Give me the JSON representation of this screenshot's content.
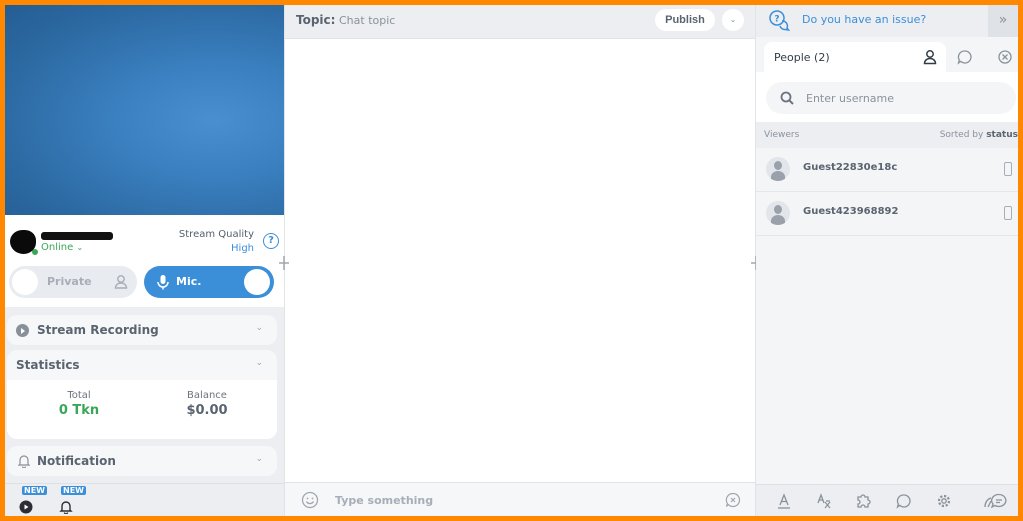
{
  "profile": {
    "status": "Online",
    "status_caret": "⌄",
    "stream_quality_label": "Stream Quality",
    "stream_quality_value": "High",
    "help_glyph": "?"
  },
  "toggles": {
    "private_label": "Private",
    "private_on": false,
    "mic_label": "Mic.",
    "mic_on": true
  },
  "sections": {
    "recording_title": "Stream Recording",
    "statistics_title": "Statistics",
    "notification_title": "Notification",
    "chevron": "⌄"
  },
  "statistics": {
    "total_label": "Total",
    "total_value": "0 Tkn",
    "balance_label": "Balance",
    "balance_value": "$0.00"
  },
  "bottom_left": {
    "badge1": "NEW",
    "badge2": "NEW"
  },
  "chat": {
    "topic_label": "Topic:",
    "topic_value": "Chat topic",
    "publish_label": "Publish",
    "dropdown_glyph": "⌄",
    "input_placeholder": "Type something"
  },
  "right_panel": {
    "issue_link": "Do you have an issue?",
    "collapse_glyph": "»",
    "people_tab_label": "People  (2)",
    "search_placeholder": "Enter username",
    "viewers_label": "Viewers",
    "sorted_by_label": "Sorted by",
    "sorted_by_value": "status",
    "viewers": [
      {
        "name": "Guest22830e18c",
        "device": "mobile-icon"
      },
      {
        "name": "Guest423968892",
        "device": "mobile-icon"
      }
    ]
  },
  "colors": {
    "accent": "#3b8fd9",
    "online": "#3aa657",
    "token_green": "#3aa657",
    "frame_border": "#ff8800"
  }
}
